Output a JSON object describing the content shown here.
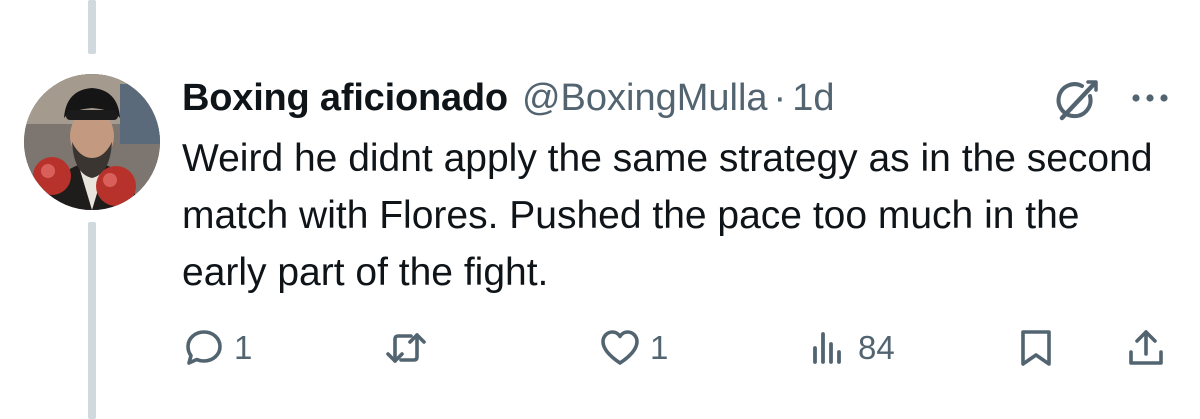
{
  "tweet": {
    "author": {
      "display_name": "Boxing aficionado",
      "handle": "@BoxingMulla",
      "separator": "·",
      "time": "1d"
    },
    "text": "Weird he didnt apply the same strategy as in the second match with Flores. Pushed the pace too much in the early part of the fight.",
    "metrics": {
      "replies": "1",
      "likes": "1",
      "views": "84"
    }
  },
  "icons": {
    "grok": "grok-icon",
    "more": "more-options-icon",
    "reply": "reply-icon",
    "retweet": "retweet-icon",
    "like": "heart-icon",
    "views": "views-bar-chart-icon",
    "bookmark": "bookmark-icon",
    "share": "share-icon"
  },
  "colors": {
    "text_primary": "#0f1419",
    "text_secondary": "#536471",
    "thread_line": "#cfd9de"
  }
}
